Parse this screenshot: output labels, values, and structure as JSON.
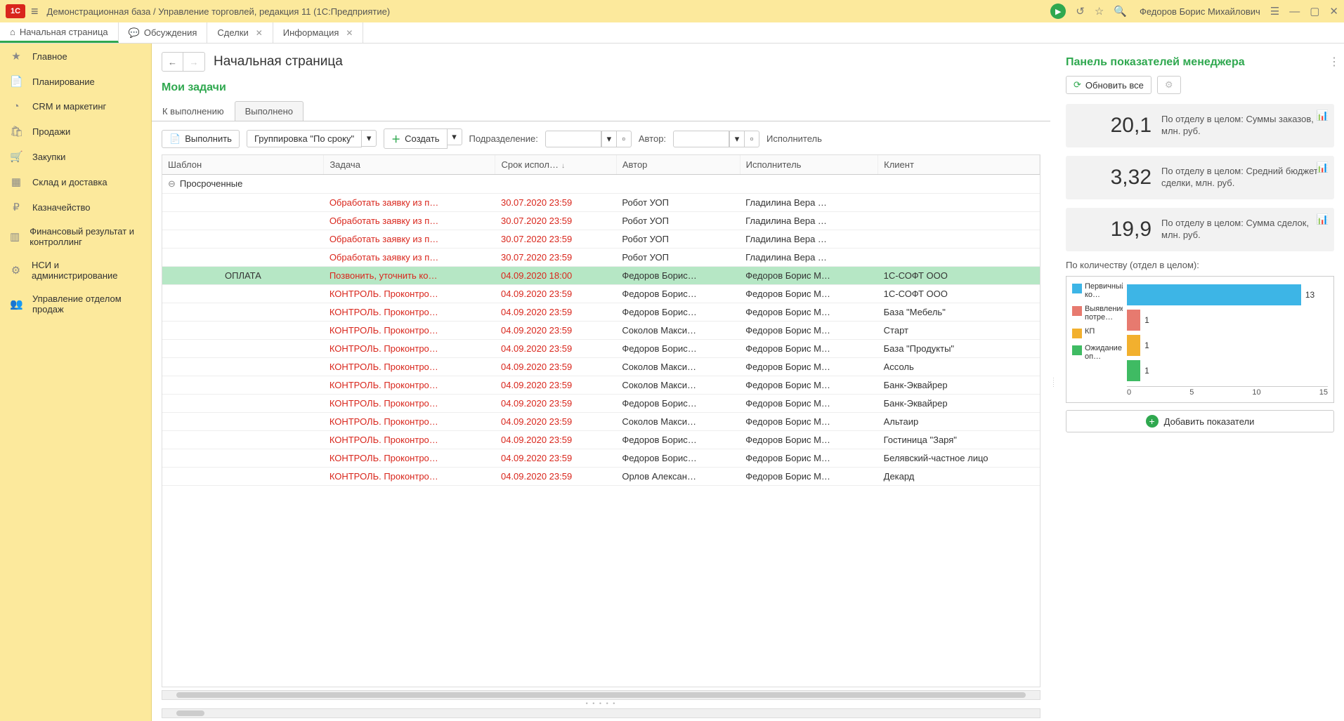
{
  "titlebar": {
    "logo": "1C",
    "title": "Демонстрационная база / Управление торговлей, редакция 11  (1С:Предприятие)",
    "user": "Федоров Борис Михайлович"
  },
  "tabs": [
    {
      "label": "Начальная страница",
      "icon": "⌂",
      "active": true,
      "closable": false
    },
    {
      "label": "Обсуждения",
      "icon": "💬",
      "active": false,
      "closable": false
    },
    {
      "label": "Сделки",
      "icon": "",
      "active": false,
      "closable": true
    },
    {
      "label": "Информация",
      "icon": "",
      "active": false,
      "closable": true
    }
  ],
  "sidebar": {
    "items": [
      {
        "label": "Главное",
        "icon": "★"
      },
      {
        "label": "Планирование",
        "icon": "📄"
      },
      {
        "label": "CRM и маркетинг",
        "icon": "◔"
      },
      {
        "label": "Продажи",
        "icon": "🛍"
      },
      {
        "label": "Закупки",
        "icon": "🛒"
      },
      {
        "label": "Склад и доставка",
        "icon": "▦"
      },
      {
        "label": "Казначейство",
        "icon": "₽"
      },
      {
        "label": "Финансовый результат и контроллинг",
        "icon": "▥"
      },
      {
        "label": "НСИ и администрирование",
        "icon": "⚙"
      },
      {
        "label": "Управление отделом продаж",
        "icon": "👥"
      }
    ]
  },
  "page": {
    "title": "Начальная страница",
    "section": "Мои задачи",
    "subtabs": {
      "pending": "К выполнению",
      "done": "Выполнено"
    },
    "toolbar": {
      "execute": "Выполнить",
      "grouping": "Группировка \"По сроку\"",
      "create": "Создать",
      "department_label": "Подразделение:",
      "author_label": "Автор:",
      "executor_label": "Исполнитель"
    },
    "columns": {
      "template": "Шаблон",
      "task": "Задача",
      "due": "Срок испол…",
      "author": "Автор",
      "executor": "Исполнитель",
      "client": "Клиент"
    },
    "group": "Просроченные",
    "rows": [
      {
        "template": "",
        "task": "Обработать заявку из п…",
        "due": "30.07.2020 23:59",
        "author": "Робот УОП",
        "executor": "Гладилина Вера …",
        "client": "",
        "hl": false
      },
      {
        "template": "",
        "task": "Обработать заявку из п…",
        "due": "30.07.2020 23:59",
        "author": "Робот УОП",
        "executor": "Гладилина Вера …",
        "client": "",
        "hl": false
      },
      {
        "template": "",
        "task": "Обработать заявку из п…",
        "due": "30.07.2020 23:59",
        "author": "Робот УОП",
        "executor": "Гладилина Вера …",
        "client": "",
        "hl": false
      },
      {
        "template": "",
        "task": "Обработать заявку из п…",
        "due": "30.07.2020 23:59",
        "author": "Робот УОП",
        "executor": "Гладилина Вера …",
        "client": "",
        "hl": false
      },
      {
        "template": "ОПЛАТА",
        "task": "Позвонить, уточнить ко…",
        "due": "04.09.2020 18:00",
        "author": "Федоров Борис…",
        "executor": "Федоров Борис М…",
        "client": "1С-СОФТ ООО",
        "hl": true
      },
      {
        "template": "",
        "task": "КОНТРОЛЬ. Проконтро…",
        "due": "04.09.2020 23:59",
        "author": "Федоров Борис…",
        "executor": "Федоров Борис М…",
        "client": "1С-СОФТ ООО",
        "hl": false
      },
      {
        "template": "",
        "task": "КОНТРОЛЬ. Проконтро…",
        "due": "04.09.2020 23:59",
        "author": "Федоров Борис…",
        "executor": "Федоров Борис М…",
        "client": "База \"Мебель\"",
        "hl": false
      },
      {
        "template": "",
        "task": "КОНТРОЛЬ. Проконтро…",
        "due": "04.09.2020 23:59",
        "author": "Соколов Макси…",
        "executor": "Федоров Борис М…",
        "client": "Старт",
        "hl": false
      },
      {
        "template": "",
        "task": "КОНТРОЛЬ. Проконтро…",
        "due": "04.09.2020 23:59",
        "author": "Федоров Борис…",
        "executor": "Федоров Борис М…",
        "client": "База \"Продукты\"",
        "hl": false
      },
      {
        "template": "",
        "task": "КОНТРОЛЬ. Проконтро…",
        "due": "04.09.2020 23:59",
        "author": "Соколов Макси…",
        "executor": "Федоров Борис М…",
        "client": "Ассоль",
        "hl": false
      },
      {
        "template": "",
        "task": "КОНТРОЛЬ. Проконтро…",
        "due": "04.09.2020 23:59",
        "author": "Соколов Макси…",
        "executor": "Федоров Борис М…",
        "client": "Банк-Эквайрер",
        "hl": false
      },
      {
        "template": "",
        "task": "КОНТРОЛЬ. Проконтро…",
        "due": "04.09.2020 23:59",
        "author": "Федоров Борис…",
        "executor": "Федоров Борис М…",
        "client": "Банк-Эквайрер",
        "hl": false
      },
      {
        "template": "",
        "task": "КОНТРОЛЬ. Проконтро…",
        "due": "04.09.2020 23:59",
        "author": "Соколов Макси…",
        "executor": "Федоров Борис М…",
        "client": "Альтаир",
        "hl": false
      },
      {
        "template": "",
        "task": "КОНТРОЛЬ. Проконтро…",
        "due": "04.09.2020 23:59",
        "author": "Федоров Борис…",
        "executor": "Федоров Борис М…",
        "client": "Гостиница \"Заря\"",
        "hl": false
      },
      {
        "template": "",
        "task": "КОНТРОЛЬ. Проконтро…",
        "due": "04.09.2020 23:59",
        "author": "Федоров Борис…",
        "executor": "Федоров Борис М…",
        "client": "Белявский-частное лицо",
        "hl": false
      },
      {
        "template": "",
        "task": "КОНТРОЛЬ. Проконтро…",
        "due": "04.09.2020 23:59",
        "author": "Орлов Алексан…",
        "executor": "Федоров Борис М…",
        "client": "Декард",
        "hl": false
      }
    ]
  },
  "panel": {
    "title": "Панель показателей менеджера",
    "refresh": "Обновить все",
    "cards": [
      {
        "value": "20,1",
        "desc": "По отделу в целом: Суммы заказов, млн. руб."
      },
      {
        "value": "3,32",
        "desc": "По отделу в целом: Средний бюджет сделки, млн. руб."
      },
      {
        "value": "19,9",
        "desc": "По отделу в целом: Сумма сделок, млн. руб."
      }
    ],
    "chart_title": "По количеству (отдел в целом):",
    "add": "Добавить показатели"
  },
  "chart_data": {
    "type": "bar",
    "orientation": "horizontal",
    "title": "По количеству (отдел в целом):",
    "categories": [
      "Первичный ко…",
      "Выявление потре…",
      "КП",
      "Ожидание оп…"
    ],
    "values": [
      13,
      1,
      1,
      1
    ],
    "colors": [
      "#3db5e6",
      "#e77a6f",
      "#f2b02e",
      "#3fbb63"
    ],
    "xlim": [
      0,
      15
    ],
    "xticks": [
      0,
      5,
      10,
      15
    ]
  }
}
